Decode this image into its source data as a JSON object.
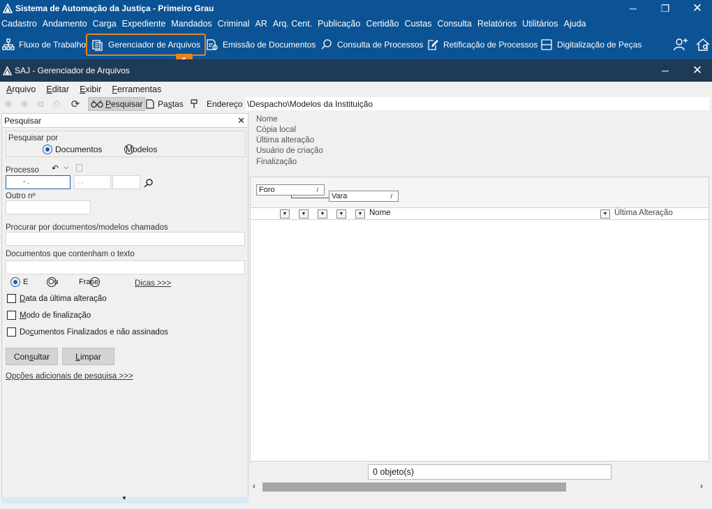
{
  "app": {
    "title": "Sistema de Automação da Justiça - Primeiro Grau",
    "menu": [
      "Cadastro",
      "Andamento",
      "Carga",
      "Expediente",
      "Mandados",
      "Criminal",
      "AR",
      "Arq. Cent.",
      "Publicação",
      "Certidão",
      "Custas",
      "Consulta",
      "Relatórios",
      "Utilitários",
      "Ajuda"
    ],
    "toolbar": {
      "fluxo": "Fluxo de Trabalho",
      "gerenciador": "Gerenciador de Arquivos",
      "emissao": "Emissão de Documentos",
      "consulta": "Consulta de Processos",
      "retificacao": "Retificação de Processos",
      "digitalizacao": "Digitalização de Peças"
    },
    "highlight_badge": "1",
    "accent_color": "#e8841a",
    "titlebar_color": "#0b5394"
  },
  "window": {
    "title": "SAJ - Gerenciador de Arquivos",
    "menu": {
      "arquivo_first": "A",
      "arquivo_rest": "rquivo",
      "editar_first": "E",
      "editar_rest": "ditar",
      "exibir_first": "E",
      "exibir_rest": "xibir",
      "ferramentas_first": "F",
      "ferramentas_rest": "erramentas"
    },
    "toolbar": {
      "pesquisar_first": "P",
      "pesquisar_rest": "esquisar",
      "pastas_pre": "Pa",
      "pastas_u": "s",
      "pastas_post": "tas",
      "endereco_label": "Endereço",
      "endereco_value": "\\Despacho\\Modelos da Instituição"
    }
  },
  "search_panel": {
    "title": "Pesquisar",
    "pesquisar_por": "Pesquisar por",
    "opt_documentos": "Documentos",
    "opt_modelos": "Modelos",
    "processo_label": "Processo",
    "processo_mask1": "-   .",
    "processo_mask2": ".   .",
    "outro_label": "Outro nº",
    "procurar_label": "Procurar por documentos/modelos chamados",
    "contenham_label": "Documentos que contenham o texto",
    "opt_e": "E",
    "opt_ou": "Ou",
    "opt_frase": "Frase",
    "dicas": "Dicas >>>",
    "chk_data_first": "D",
    "chk_data_rest": "ata da última alteração",
    "chk_modo_first": "M",
    "chk_modo_rest": "odo de finalização",
    "chk_final_pre": "Do",
    "chk_final_u": "c",
    "chk_final_post": "umentos Finalizados e não assinados",
    "btn_consultar_pre": "Con",
    "btn_consultar_u": "s",
    "btn_consultar_post": "ultar",
    "btn_limpar_first": "L",
    "btn_limpar_rest": "impar",
    "opcoes": "Opções adicionais de pesquisa >>>"
  },
  "details": {
    "nome": "Nome",
    "copia": "Cópia local",
    "ultima": "Última alteração",
    "usuario": "Usuário de criação",
    "finalizacao": "Finalização"
  },
  "grid": {
    "group_foro": "Foro",
    "group_vara": "Vara",
    "col_nome": "Nome",
    "col_ultima": "Última Alteração",
    "status": "0 objeto(s)"
  }
}
